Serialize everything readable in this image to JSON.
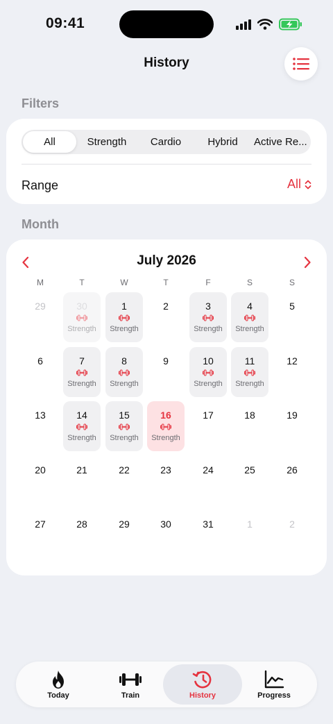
{
  "status_bar": {
    "time": "09:41"
  },
  "header": {
    "title": "History",
    "menu_icon": "list-icon"
  },
  "filters": {
    "section_label": "Filters",
    "segments": [
      "All",
      "Strength",
      "Cardio",
      "Hybrid",
      "Active Re..."
    ],
    "selected": "All",
    "range_label": "Range",
    "range_value": "All"
  },
  "month": {
    "section_label": "Month",
    "title": "July 2026",
    "weekdays": [
      "M",
      "T",
      "W",
      "T",
      "F",
      "S",
      "S"
    ],
    "weeks": [
      [
        {
          "n": "29",
          "other": true
        },
        {
          "n": "30",
          "other": true,
          "workout": "Strength"
        },
        {
          "n": "1",
          "workout": "Strength"
        },
        {
          "n": "2"
        },
        {
          "n": "3",
          "workout": "Strength"
        },
        {
          "n": "4",
          "workout": "Strength"
        },
        {
          "n": "5"
        }
      ],
      [
        {
          "n": "6"
        },
        {
          "n": "7",
          "workout": "Strength"
        },
        {
          "n": "8",
          "workout": "Strength"
        },
        {
          "n": "9"
        },
        {
          "n": "10",
          "workout": "Strength"
        },
        {
          "n": "11",
          "workout": "Strength"
        },
        {
          "n": "12"
        }
      ],
      [
        {
          "n": "13"
        },
        {
          "n": "14",
          "workout": "Strength"
        },
        {
          "n": "15",
          "workout": "Strength"
        },
        {
          "n": "16",
          "workout": "Strength",
          "today": true
        },
        {
          "n": "17"
        },
        {
          "n": "18"
        },
        {
          "n": "19"
        }
      ],
      [
        {
          "n": "20"
        },
        {
          "n": "21"
        },
        {
          "n": "22"
        },
        {
          "n": "23"
        },
        {
          "n": "24"
        },
        {
          "n": "25"
        },
        {
          "n": "26"
        }
      ],
      [
        {
          "n": "27"
        },
        {
          "n": "28"
        },
        {
          "n": "29"
        },
        {
          "n": "30"
        },
        {
          "n": "31"
        },
        {
          "n": "1",
          "other": true
        },
        {
          "n": "2",
          "other": true
        }
      ]
    ]
  },
  "tabbar": {
    "items": [
      {
        "label": "Today",
        "icon": "flame-icon"
      },
      {
        "label": "Train",
        "icon": "dumbbell-icon"
      },
      {
        "label": "History",
        "icon": "history-icon",
        "active": true
      },
      {
        "label": "Progress",
        "icon": "chart-icon"
      }
    ]
  },
  "colors": {
    "accent": "#e5333f",
    "background": "#eef0f5",
    "today_fill": "#fde1e3"
  }
}
